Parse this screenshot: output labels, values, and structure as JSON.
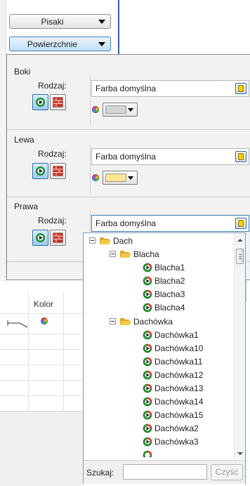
{
  "top_buttons": {
    "pisaki": "Pisaki",
    "powierzchnie": "Powierzchnie"
  },
  "sections": [
    {
      "title": "Boki",
      "rodzaj": "Rodzaj:",
      "combo": "Farba domyślna",
      "color_swatch": "#d4d4d4"
    },
    {
      "title": "Lewa",
      "rodzaj": "Rodzaj:",
      "combo": "Farba domyślna",
      "color_swatch": "#ffe58f"
    },
    {
      "title": "Prawa",
      "rodzaj": "Rodzaj:",
      "combo": "Farba domyślna"
    }
  ],
  "background": {
    "column_kolor": "Kolor"
  },
  "tree": {
    "root": "Dach",
    "group1": {
      "label": "Blacha",
      "items": [
        "Blacha1",
        "Blacha2",
        "Blacha3",
        "Blacha4"
      ]
    },
    "group2": {
      "label": "Dachówka",
      "items": [
        "Dachówka1",
        "Dachówka10",
        "Dachówka11",
        "Dachówka12",
        "Dachówka13",
        "Dachówka14",
        "Dachówka15",
        "Dachówka2",
        "Dachówka3"
      ]
    }
  },
  "search": {
    "label": "Szukaj:",
    "value": "",
    "clear": "Czyść"
  },
  "colors": {
    "accent": "#3c7fb1",
    "folder": "#f6c94a",
    "panel": "#f2f2f2"
  }
}
